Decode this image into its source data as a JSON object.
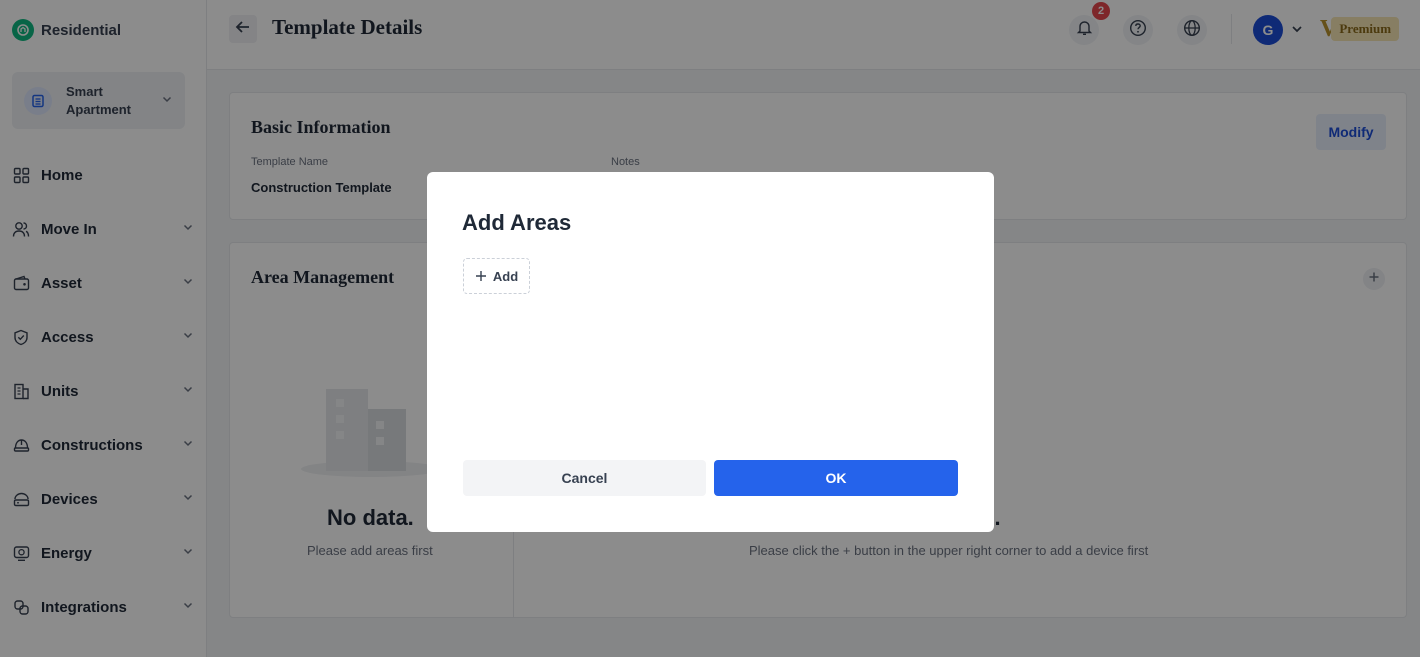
{
  "brand": {
    "name": "Residential"
  },
  "project": {
    "name": "Smart Apartment"
  },
  "sidebar": {
    "items": [
      {
        "label": "Home",
        "icon": "grid-icon",
        "expandable": false
      },
      {
        "label": "Move In",
        "icon": "users-icon",
        "expandable": true
      },
      {
        "label": "Asset",
        "icon": "wallet-icon",
        "expandable": true
      },
      {
        "label": "Access",
        "icon": "shield-icon",
        "expandable": true
      },
      {
        "label": "Units",
        "icon": "building-icon",
        "expandable": true
      },
      {
        "label": "Constructions",
        "icon": "helmet-icon",
        "expandable": true
      },
      {
        "label": "Devices",
        "icon": "devices-icon",
        "expandable": true
      },
      {
        "label": "Energy",
        "icon": "energy-icon",
        "expandable": true
      },
      {
        "label": "Integrations",
        "icon": "integrations-icon",
        "expandable": true
      }
    ]
  },
  "header": {
    "title": "Template Details",
    "notification_count": "2",
    "avatar_letter": "G",
    "premium_mark": "V",
    "premium_label": "Premium"
  },
  "basic_info": {
    "title": "Basic Information",
    "modify_label": "Modify",
    "template_name_label": "Template Name",
    "template_name_value": "Construction Template",
    "notes_label": "Notes"
  },
  "area_management": {
    "title": "Area Management",
    "left_empty_title": "No data.",
    "left_empty_sub": "Please add areas first",
    "right_empty_title_partial": "n.",
    "right_empty_sub": "Please click the + button in the upper right corner to add a device first"
  },
  "modal": {
    "title": "Add Areas",
    "add_label": "Add",
    "cancel_label": "Cancel",
    "ok_label": "OK"
  },
  "colors": {
    "primary": "#2563eb",
    "brand_green": "#10b981",
    "badge_red": "#e5484d",
    "overlay": "rgba(0,0,0,0.45)"
  }
}
